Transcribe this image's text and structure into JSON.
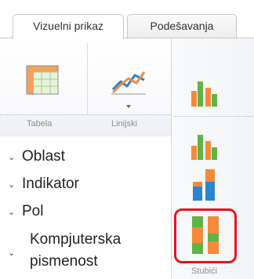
{
  "tabs": [
    {
      "label": "Vizuelni prikaz",
      "active": true
    },
    {
      "label": "Podešavanja",
      "active": false
    }
  ],
  "ribbon": {
    "groups": [
      {
        "label": "Tabela",
        "icon": "table-icon"
      },
      {
        "label": "Linijski",
        "icon": "line-chart-icon"
      }
    ]
  },
  "chart_types": {
    "group_label": "Stubići",
    "buttons": [
      {
        "icon": "bar-chart-icon"
      },
      {
        "icon": "stacked-bar-chart-icon"
      },
      {
        "icon": "stacked-bar-chart-blue-icon"
      },
      {
        "icon": "percent-stacked-bar-chart-icon",
        "highlighted": true
      }
    ]
  },
  "nav": {
    "items": [
      {
        "label": "Oblast"
      },
      {
        "label": "Indikator"
      },
      {
        "label": "Pol"
      }
    ],
    "multi": {
      "line1": "Kompjuterska",
      "line2": "pismenost"
    }
  },
  "colors": {
    "orange": "#f58a3a",
    "green": "#61b342",
    "blue": "#2a85d0",
    "red_highlight": "#e8151b"
  }
}
